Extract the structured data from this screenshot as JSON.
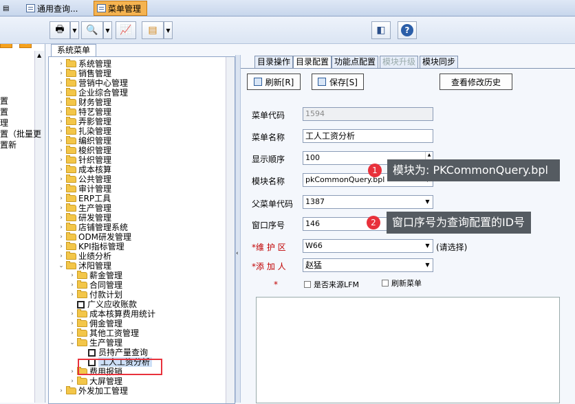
{
  "top_tabs": [
    {
      "label": "通用查询..."
    },
    {
      "label": "菜单管理",
      "active": true
    }
  ],
  "left_strip": {
    "pin": "⊕",
    "close": "✕",
    "items": [
      "置",
      "置",
      "理",
      "置（批量更",
      "置新"
    ]
  },
  "tree": {
    "tab_label": "系统菜单",
    "nodes": [
      {
        "label": "系统管理",
        "indent": 0,
        "type": "folder",
        "expander": "›"
      },
      {
        "label": "销售管理",
        "indent": 0,
        "type": "folder",
        "expander": "›"
      },
      {
        "label": "营销中心管理",
        "indent": 0,
        "type": "folder",
        "expander": "›"
      },
      {
        "label": "企业综合管理",
        "indent": 0,
        "type": "folder",
        "expander": "›"
      },
      {
        "label": "财务管理",
        "indent": 0,
        "type": "folder",
        "expander": "›"
      },
      {
        "label": "特艺管理",
        "indent": 0,
        "type": "folder",
        "expander": "›"
      },
      {
        "label": "弄影管理",
        "indent": 0,
        "type": "folder",
        "expander": "›"
      },
      {
        "label": "扎染管理",
        "indent": 0,
        "type": "folder",
        "expander": "›"
      },
      {
        "label": "编织管理",
        "indent": 0,
        "type": "folder",
        "expander": "›"
      },
      {
        "label": "梭织管理",
        "indent": 0,
        "type": "folder",
        "expander": "›"
      },
      {
        "label": "针织管理",
        "indent": 0,
        "type": "folder",
        "expander": "›"
      },
      {
        "label": "成本核算",
        "indent": 0,
        "type": "folder",
        "expander": "›"
      },
      {
        "label": "公共管理",
        "indent": 0,
        "type": "folder",
        "expander": "›"
      },
      {
        "label": "审计管理",
        "indent": 0,
        "type": "folder",
        "expander": "›"
      },
      {
        "label": "ERP工具",
        "indent": 0,
        "type": "folder",
        "expander": "›"
      },
      {
        "label": "生产管理",
        "indent": 0,
        "type": "folder",
        "expander": "›"
      },
      {
        "label": "研发管理",
        "indent": 0,
        "type": "folder",
        "expander": "›"
      },
      {
        "label": "店铺管理系统",
        "indent": 0,
        "type": "folder",
        "expander": "›"
      },
      {
        "label": "ODM研发管理",
        "indent": 0,
        "type": "folder",
        "expander": "›"
      },
      {
        "label": "KPI指标管理",
        "indent": 0,
        "type": "folder",
        "expander": "›"
      },
      {
        "label": "业绩分析",
        "indent": 0,
        "type": "folder",
        "expander": "›"
      },
      {
        "label": "沭阳管理",
        "indent": 0,
        "type": "folder",
        "expander": "⌄"
      },
      {
        "label": "薪金管理",
        "indent": 1,
        "type": "folder",
        "expander": "›"
      },
      {
        "label": "合同管理",
        "indent": 1,
        "type": "folder",
        "expander": "›"
      },
      {
        "label": "付款计划",
        "indent": 1,
        "type": "folder",
        "expander": "›"
      },
      {
        "label": "广义应收账款",
        "indent": 1,
        "type": "leaf",
        "expander": ""
      },
      {
        "label": "成本核算费用统计",
        "indent": 1,
        "type": "folder",
        "expander": "›"
      },
      {
        "label": "佣金管理",
        "indent": 1,
        "type": "folder",
        "expander": "›"
      },
      {
        "label": "其他工资管理",
        "indent": 1,
        "type": "folder",
        "expander": "›"
      },
      {
        "label": "生产管理",
        "indent": 1,
        "type": "folder",
        "expander": "⌄"
      },
      {
        "label": "员持产量查询",
        "indent": 2,
        "type": "leaf",
        "expander": ""
      },
      {
        "label": "工人工资分析",
        "indent": 2,
        "type": "leaf",
        "expander": "",
        "selected": true
      },
      {
        "label": "费用报销",
        "indent": 1,
        "type": "folder",
        "expander": "›"
      },
      {
        "label": "大屏管理",
        "indent": 1,
        "type": "folder",
        "expander": "›"
      },
      {
        "label": "外发加工管理",
        "indent": 0,
        "type": "folder",
        "expander": "›"
      }
    ]
  },
  "right": {
    "tabs": [
      {
        "label": "目录操作"
      },
      {
        "label": "目录配置",
        "active": true
      },
      {
        "label": "功能点配置"
      },
      {
        "label": "模块升级",
        "disabled": true
      },
      {
        "label": "模块同步"
      }
    ],
    "buttons": {
      "refresh": "刷新[R]",
      "save": "保存[S]",
      "history": "查看修改历史"
    },
    "form": {
      "menu_code": {
        "label": "菜单代码",
        "value": "1594"
      },
      "menu_name": {
        "label": "菜单名称",
        "value": "工人工资分析"
      },
      "display_order": {
        "label": "显示顺序",
        "value": "100"
      },
      "module_name": {
        "label": "模块名称",
        "value": "pkCommonQuery.bpl"
      },
      "parent_code": {
        "label": "父菜单代码",
        "value": "1387"
      },
      "window_no": {
        "label": "窗口序号",
        "value": "146"
      },
      "maintain_area": {
        "label": "*维 护 区",
        "value": "W66",
        "hint": "(请选择)"
      },
      "adder": {
        "label": "*添 加 人",
        "value": "赵猛"
      },
      "star": "*",
      "chk_lfm": "是否来源LFM",
      "chk_refresh": "刷新菜单"
    }
  },
  "callouts": [
    {
      "num": "1",
      "text": "模块为:  PKCommonQuery.bpl"
    },
    {
      "num": "2",
      "text": "窗口序号为查询配置的ID号"
    }
  ]
}
